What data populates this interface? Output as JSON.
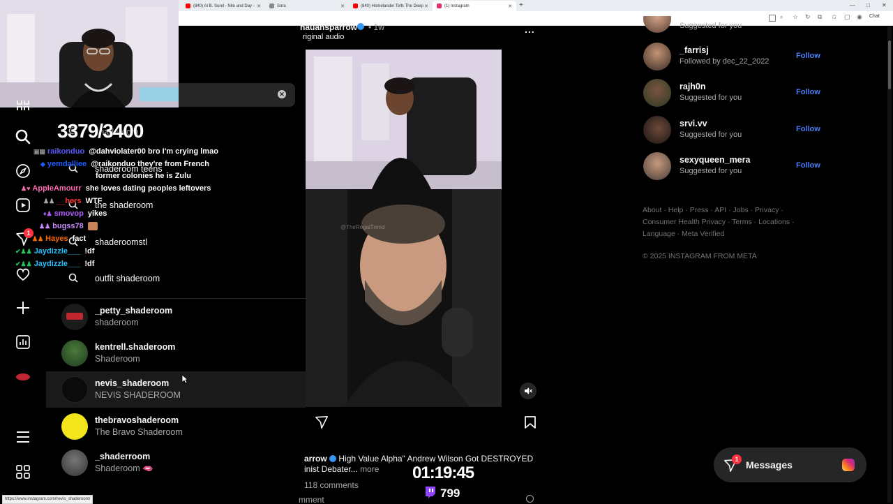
{
  "browser": {
    "tabs": [
      {
        "label": "(840) AI B. Surel - Nite and Day -",
        "icon_color": "#ff0000"
      },
      {
        "label": "Sora",
        "icon_color": "#666666"
      },
      {
        "label": "(840) Homelander Tells The Deep",
        "icon_color": "#ff0000"
      },
      {
        "label": "(1) Instagram",
        "icon_color": "#e1306c"
      }
    ],
    "new_tab": "+",
    "profile_label": "Chat",
    "window_controls": [
      "—",
      "□",
      "✕"
    ],
    "status_url": "https://www.instagram.com/nevis_shaderoom/"
  },
  "overlay": {
    "goal_counter": "3379/3400",
    "subathon_timer": "01:19:45",
    "twitch_viewers": "799",
    "chat": [
      {
        "name": "raikonduo",
        "name_color": "#5a5aff",
        "text": "@dahviolater00 bro I'm crying lmao"
      },
      {
        "name": "yemdalliee",
        "name_color": "#1e5cff",
        "text": "@raikonduo they're from French"
      },
      {
        "name": "",
        "name_color": "#ffffff",
        "text": "former colonies he is Zulu"
      },
      {
        "name": "AppleAmourr",
        "name_color": "#ff69b4",
        "text": "she loves dating peoples leftovers"
      },
      {
        "name": "__hers",
        "name_color": "#ff3333",
        "text": "WTF"
      },
      {
        "name": "smovop",
        "name_color": "#b05cff",
        "text": "yikes"
      },
      {
        "name": "bugss78",
        "name_color": "#c88cff",
        "text": ""
      },
      {
        "name": "Hayes",
        "name_color": "#ff6a00",
        "text": "fact"
      },
      {
        "name": "Jaydizzle___",
        "name_color": "#22c0ff",
        "text": "!df"
      },
      {
        "name": "Jaydizzle___",
        "name_color": "#22c0ff",
        "text": "!df"
      }
    ]
  },
  "sidebar": {
    "notification_count": "1",
    "items": [
      "grid-icon",
      "search-icon",
      "explore-icon",
      "reels-icon",
      "messages-icon",
      "notifications-icon",
      "create-icon",
      "dashboard-icon",
      "profile-icon",
      "menu-icon",
      "more-icon"
    ]
  },
  "search": {
    "clear_icon": "clear-icon",
    "recent": [
      {
        "label": "shaderoom"
      },
      {
        "label": "shaderoom teens"
      },
      {
        "label": "the shaderoom"
      },
      {
        "label": "shaderoomstl"
      },
      {
        "label": "outfit shaderoom"
      }
    ],
    "results": [
      {
        "username": "_petty_shaderoom",
        "name": "shaderoom",
        "avatar_color": "#1b1b1b"
      },
      {
        "username": "kentrell.shaderoom",
        "name": "Shaderoom",
        "avatar_color": "#1f3a1f"
      },
      {
        "username": "nevis_shaderoom",
        "name": "NEVIS SHADEROOM",
        "avatar_color": "#0b0b0b"
      },
      {
        "username": "thebravoshaderoom",
        "name": "The Bravo Shaderoom",
        "avatar_color": "#f2e51c"
      },
      {
        "username": "_shaderroom",
        "name": "Shaderoom 🫦",
        "avatar_color": "#444444"
      }
    ]
  },
  "post": {
    "author": "hauansparrow",
    "time": "1w",
    "audio": "riginal audio",
    "more_icon": "...",
    "watermark": "@TheRegalTrend",
    "caption_author": "arrow",
    "caption": "High Value Alpha\" Andrew Wilson Got DESTROYED",
    "caption_line2": "inist Debater...",
    "more_label": "more",
    "comments": "118 comments",
    "add_comment": "mment"
  },
  "suggestions": [
    {
      "username": "",
      "subtitle": "Suggested for you",
      "follow": ""
    },
    {
      "username": "_farrisj",
      "subtitle": "Followed by dec_22_2022",
      "follow": "Follow"
    },
    {
      "username": "rajh0n",
      "subtitle": "Suggested for you",
      "follow": "Follow"
    },
    {
      "username": "srvi.vv",
      "subtitle": "Suggested for you",
      "follow": "Follow"
    },
    {
      "username": "sexyqueen_mera",
      "subtitle": "Suggested for you",
      "follow": "Follow"
    }
  ],
  "footer": {
    "line1": "About · Help · Press · API · Jobs · Privacy ·",
    "line2": "Consumer Health Privacy · Terms · Locations ·",
    "line3": "Language · Meta Verified",
    "copyright": "© 2025 INSTAGRAM FROM META"
  },
  "messages": {
    "label": "Messages",
    "badge": "1"
  },
  "colors": {
    "link_blue": "#4a7ff8",
    "notification_red": "#ff3040",
    "muted_text": "#a8a8a8"
  }
}
